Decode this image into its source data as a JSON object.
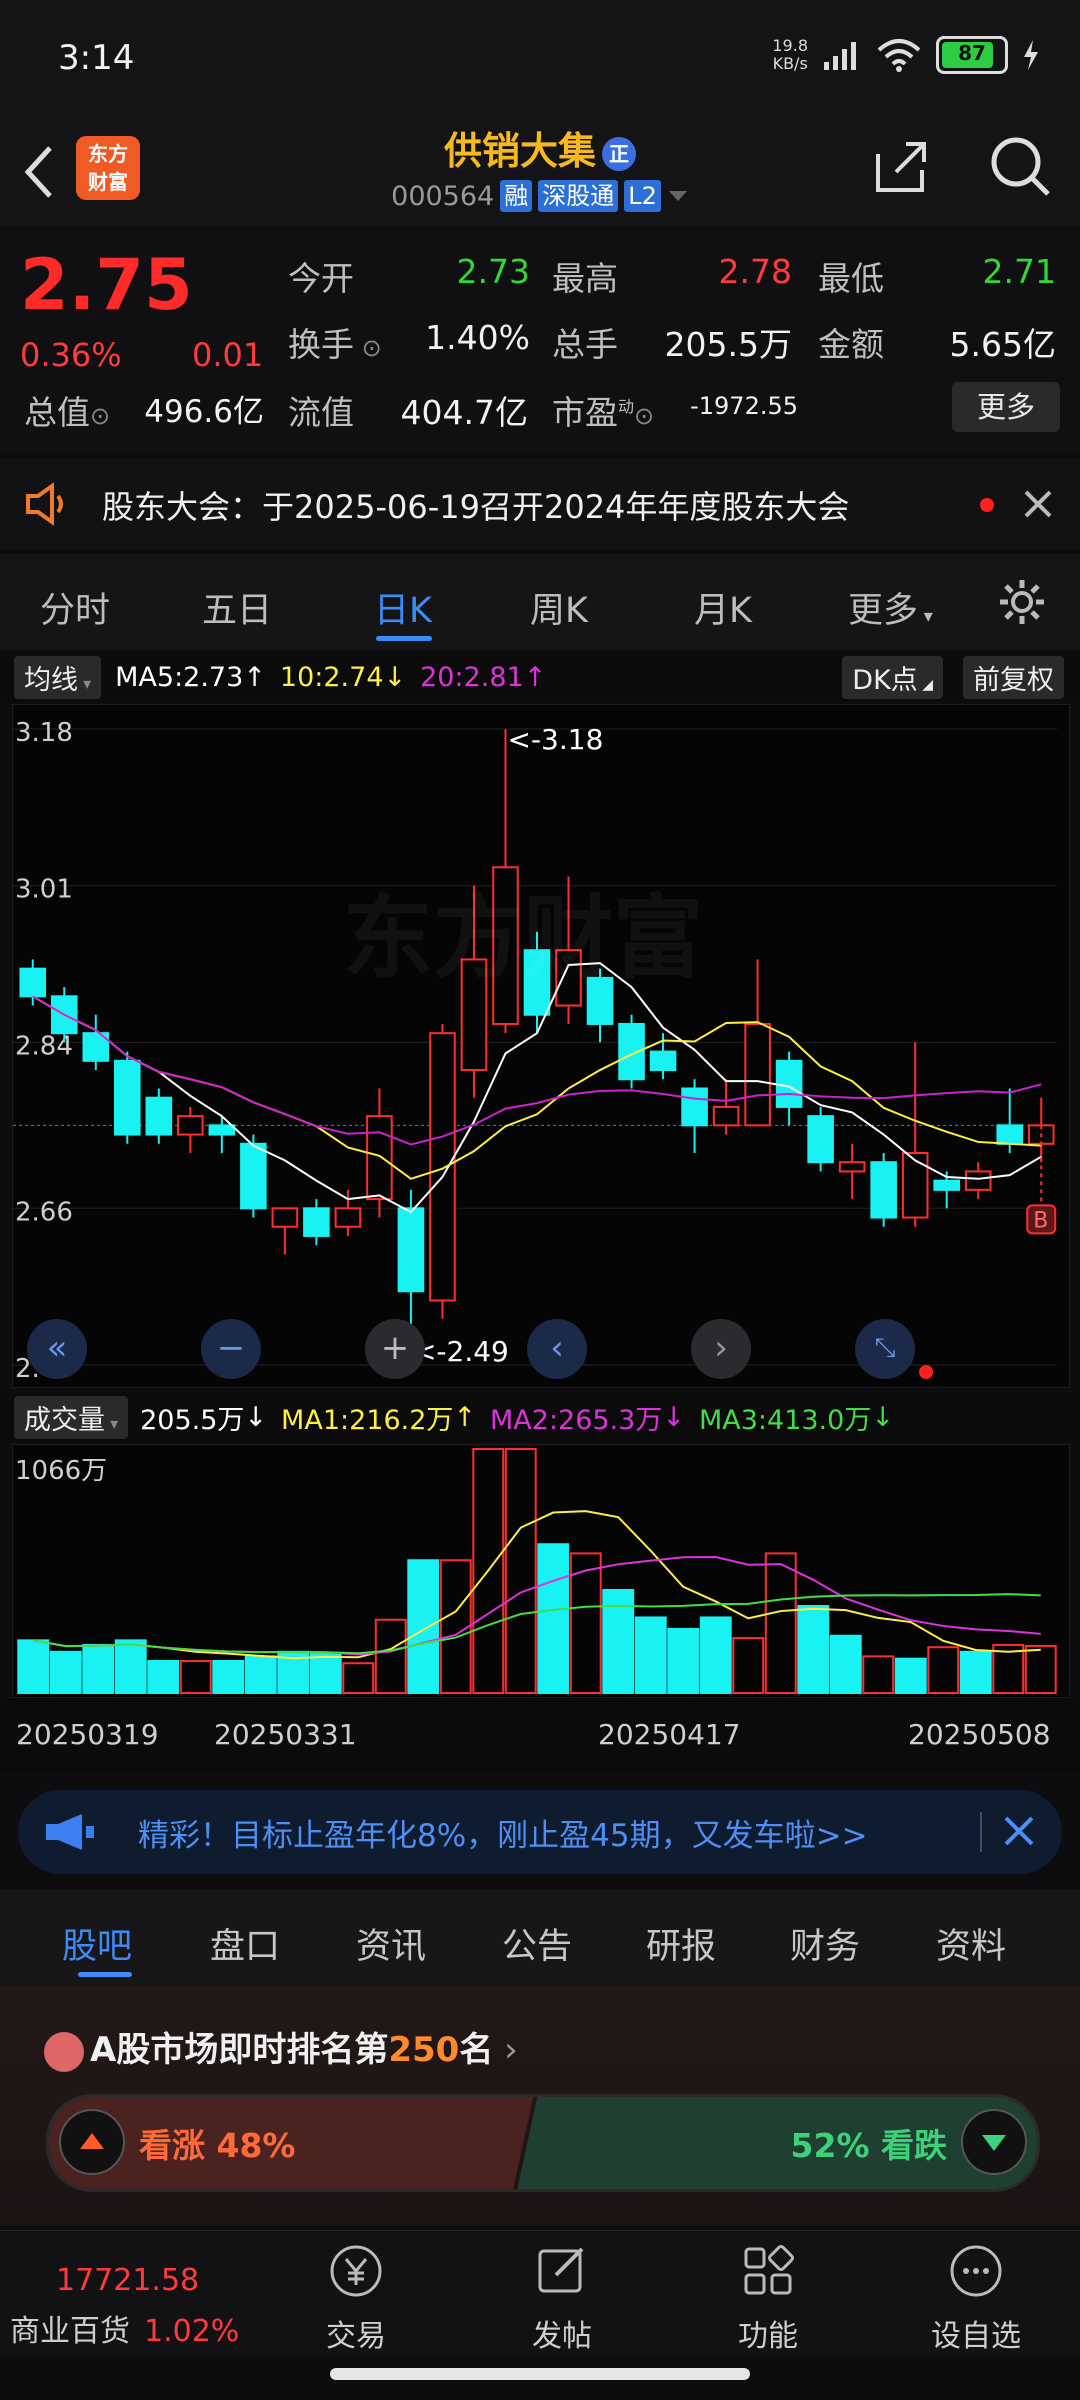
{
  "status": {
    "time": "3:14",
    "net_speed": "19.8",
    "net_unit": "KB/s",
    "battery": "87"
  },
  "header": {
    "logo_line1": "东方",
    "logo_line2": "财富",
    "name": "供销大集",
    "name_badge": "正",
    "code": "000564",
    "tags": [
      "融",
      "深股通",
      "L2"
    ]
  },
  "quote": {
    "price": "2.75",
    "change_pct": "0.36%",
    "change": "0.01",
    "fields": [
      {
        "label": "今开",
        "value": "2.73",
        "color": "#33d833"
      },
      {
        "label": "最高",
        "value": "2.78",
        "color": "#ff3b3b"
      },
      {
        "label": "最低",
        "value": "2.71",
        "color": "#33d833"
      },
      {
        "label": "换手",
        "value": "1.40%",
        "color": "#f2f2f2"
      },
      {
        "label": "总手",
        "value": "205.5万",
        "color": "#f2f2f2"
      },
      {
        "label": "金额",
        "value": "5.65亿",
        "color": "#f2f2f2"
      },
      {
        "label": "总值",
        "value": "496.6亿",
        "color": "#f2f2f2"
      },
      {
        "label": "流值",
        "value": "404.7亿",
        "color": "#f2f2f2"
      },
      {
        "label": "市盈",
        "value": "-1972.55",
        "color": "#f2f2f2"
      }
    ],
    "pe_sup": "动",
    "more_label": "更多"
  },
  "notice": {
    "text": "股东大会：于2025-06-19召开2024年年度股东大会"
  },
  "tabs": [
    "分时",
    "五日",
    "日K",
    "周K",
    "月K",
    "更多"
  ],
  "ma_row": {
    "selector": "均线",
    "ma5": "MA5:2.73",
    "ma10": "10:2.74",
    "ma20": "20:2.81",
    "dk": "DK点",
    "adjust": "前复权"
  },
  "vol_row": {
    "selector": "成交量",
    "vol": "205.5万",
    "ma1": "MA1:216.2万",
    "ma2": "MA2:265.3万",
    "ma3": "MA3:413.0万"
  },
  "chart_data": {
    "type": "candlestick",
    "y_ticks": [
      "3.18",
      "3.01",
      "2.84",
      "2.66",
      "2.49"
    ],
    "ylim": [
      2.49,
      3.18
    ],
    "high_label": "<-3.18",
    "low_label": "<-2.49",
    "marker": "B",
    "candles": [
      [
        2.92,
        2.89,
        2.93,
        2.88
      ],
      [
        2.89,
        2.85,
        2.9,
        2.84
      ],
      [
        2.85,
        2.82,
        2.87,
        2.81
      ],
      [
        2.82,
        2.74,
        2.83,
        2.73
      ],
      [
        2.78,
        2.74,
        2.79,
        2.73
      ],
      [
        2.74,
        2.76,
        2.77,
        2.72
      ],
      [
        2.75,
        2.74,
        2.76,
        2.72
      ],
      [
        2.73,
        2.66,
        2.74,
        2.65
      ],
      [
        2.64,
        2.66,
        2.66,
        2.61
      ],
      [
        2.66,
        2.63,
        2.67,
        2.62
      ],
      [
        2.64,
        2.66,
        2.68,
        2.63
      ],
      [
        2.67,
        2.76,
        2.79,
        2.65
      ],
      [
        2.66,
        2.57,
        2.68,
        2.49
      ],
      [
        2.56,
        2.85,
        2.86,
        2.54
      ],
      [
        2.81,
        2.93,
        3.01,
        2.78
      ],
      [
        2.86,
        3.03,
        3.18,
        2.85
      ],
      [
        2.94,
        2.87,
        2.96,
        2.85
      ],
      [
        2.88,
        2.94,
        3.02,
        2.86
      ],
      [
        2.91,
        2.86,
        2.92,
        2.84
      ],
      [
        2.86,
        2.8,
        2.87,
        2.79
      ],
      [
        2.83,
        2.81,
        2.85,
        2.8
      ],
      [
        2.79,
        2.75,
        2.8,
        2.72
      ],
      [
        2.75,
        2.77,
        2.8,
        2.74
      ],
      [
        2.75,
        2.86,
        2.93,
        2.75
      ],
      [
        2.82,
        2.77,
        2.83,
        2.75
      ],
      [
        2.76,
        2.71,
        2.77,
        2.7
      ],
      [
        2.7,
        2.71,
        2.73,
        2.67
      ],
      [
        2.71,
        2.65,
        2.72,
        2.64
      ],
      [
        2.65,
        2.72,
        2.84,
        2.64
      ],
      [
        2.69,
        2.68,
        2.7,
        2.66
      ],
      [
        2.68,
        2.7,
        2.71,
        2.67
      ],
      [
        2.75,
        2.73,
        2.79,
        2.72
      ],
      [
        2.73,
        2.75,
        2.78,
        2.71
      ]
    ],
    "volume": {
      "max_label": "1066万",
      "values": [
        230,
        180,
        210,
        230,
        140,
        140,
        140,
        160,
        180,
        170,
        130,
        320,
        580,
        580,
        1066,
        1066,
        650,
        610,
        450,
        330,
        280,
        330,
        240,
        610,
        380,
        250,
        160,
        150,
        200,
        180,
        210,
        205.5
      ],
      "up": [
        false,
        false,
        false,
        false,
        false,
        true,
        false,
        false,
        false,
        false,
        true,
        true,
        false,
        true,
        true,
        true,
        false,
        true,
        false,
        false,
        false,
        false,
        true,
        true,
        false,
        false,
        true,
        false,
        true,
        false,
        true,
        true
      ]
    },
    "x_labels": [
      "20250319",
      "20250331",
      "20250417",
      "20250508"
    ]
  },
  "ad": {
    "text": "精彩！目标止盈年化8%，刚止盈45期，又发车啦>>"
  },
  "subtabs": [
    "股吧",
    "盘口",
    "资讯",
    "公告",
    "研报",
    "财务",
    "资料"
  ],
  "rank": {
    "prefix": "A股市场即时排名第",
    "number": "250",
    "suffix": "名"
  },
  "vote": {
    "up_label": "看涨 48%",
    "down_label": "52% 看跌",
    "up_ratio": 0.48
  },
  "bottom_nav": {
    "index_value": "17721.58",
    "index_name": "商业百货",
    "index_change": "1.02%",
    "items": [
      "交易",
      "发帖",
      "功能",
      "设自选"
    ]
  },
  "colors": {
    "up": "#ff2e2e",
    "down": "#19f2f2",
    "ma5": "#ffffff",
    "ma10": "#ffee44",
    "ma20": "#cc22cc"
  }
}
